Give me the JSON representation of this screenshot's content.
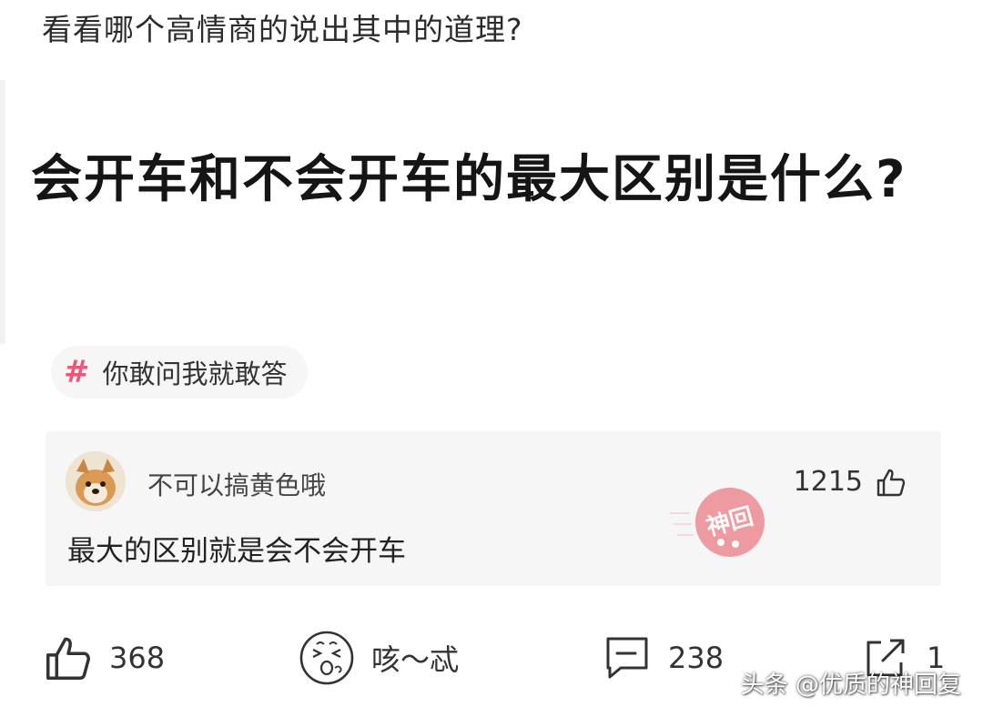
{
  "caption": "看看哪个高情商的说出其中的道理?",
  "question": {
    "title": "会开车和不会开车的最大区别是什么?"
  },
  "topic": {
    "icon": "hash-icon",
    "label": "你敢问我就敢答"
  },
  "answer": {
    "author": "不可以搞黄色哦",
    "text": "最大的区别就是会不会开车",
    "likes": "1215",
    "stamp_icon": "shenhui-stamp-icon",
    "stamp_color": "#e8505b"
  },
  "actions": {
    "like_count": "368",
    "reaction_label": "咳～忒",
    "comment_count": "238",
    "share_count": "1"
  },
  "watermark": "头条 @优质的神回复",
  "colors": {
    "accent_pink": "#f0567a",
    "card_bg": "#f6f6f7"
  }
}
